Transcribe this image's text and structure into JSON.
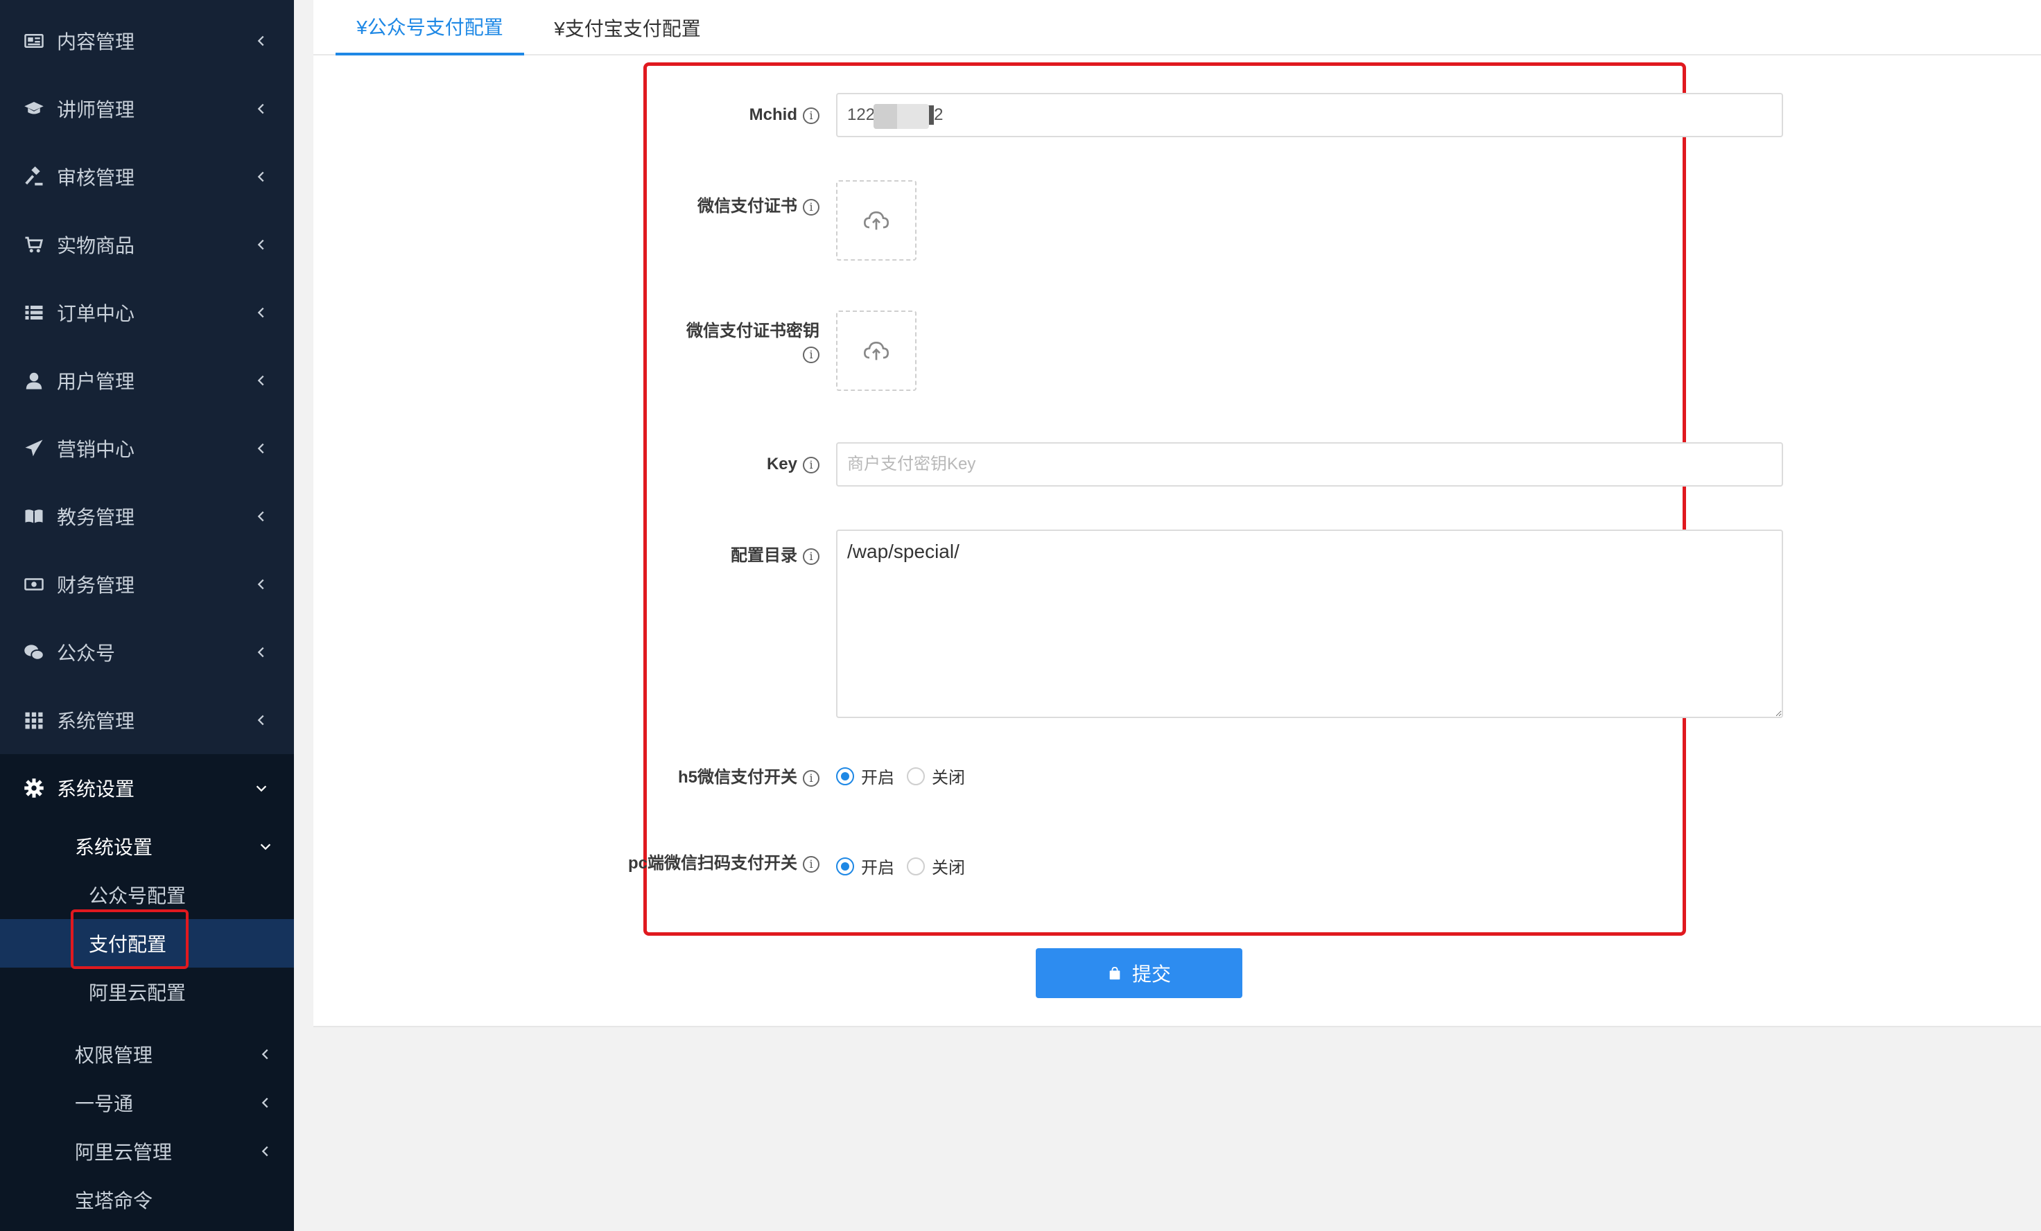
{
  "sidebar": {
    "menu": [
      {
        "label": "内容管理",
        "icon": "newspaper-icon"
      },
      {
        "label": "讲师管理",
        "icon": "graduation-cap-icon"
      },
      {
        "label": "审核管理",
        "icon": "gavel-icon"
      },
      {
        "label": "实物商品",
        "icon": "cart-icon"
      },
      {
        "label": "订单中心",
        "icon": "list-icon"
      },
      {
        "label": "用户管理",
        "icon": "user-icon"
      },
      {
        "label": "营销中心",
        "icon": "paper-plane-icon"
      },
      {
        "label": "教务管理",
        "icon": "book-icon"
      },
      {
        "label": "财务管理",
        "icon": "money-icon"
      },
      {
        "label": "公众号",
        "icon": "wechat-icon"
      },
      {
        "label": "系统管理",
        "icon": "grid-icon"
      },
      {
        "label": "系统设置",
        "icon": "gear-icon"
      }
    ],
    "submenu": {
      "group_label": "系统设置",
      "leaves": [
        "公众号配置",
        "支付配置",
        "阿里云配置"
      ],
      "active_leaf": "支付配置",
      "others": [
        "权限管理",
        "一号通",
        "阿里云管理",
        "宝塔命令"
      ]
    }
  },
  "tabs": [
    {
      "label": "¥公众号支付配置",
      "active": true
    },
    {
      "label": "¥支付宝支付配置",
      "active": false
    }
  ],
  "form": {
    "mchid": {
      "label": "Mchid",
      "value": "122█████2"
    },
    "cert": {
      "label": "微信支付证书"
    },
    "cert_key": {
      "label": "微信支付证书密钥"
    },
    "key": {
      "label": "Key",
      "placeholder": "商户支付密钥Key"
    },
    "dir": {
      "label": "配置目录",
      "value": "/wap/special/"
    },
    "h5_switch": {
      "label": "h5微信支付开关",
      "on": "开启",
      "off": "关闭",
      "selected": "开启"
    },
    "pc_switch": {
      "label": "pc端微信扫码支付开关",
      "on": "开启",
      "off": "关闭",
      "selected": "开启"
    },
    "submit": "提交"
  },
  "colors": {
    "accent": "#1e88e5",
    "sidebar": "#152235",
    "highlight": "#e0191f"
  }
}
